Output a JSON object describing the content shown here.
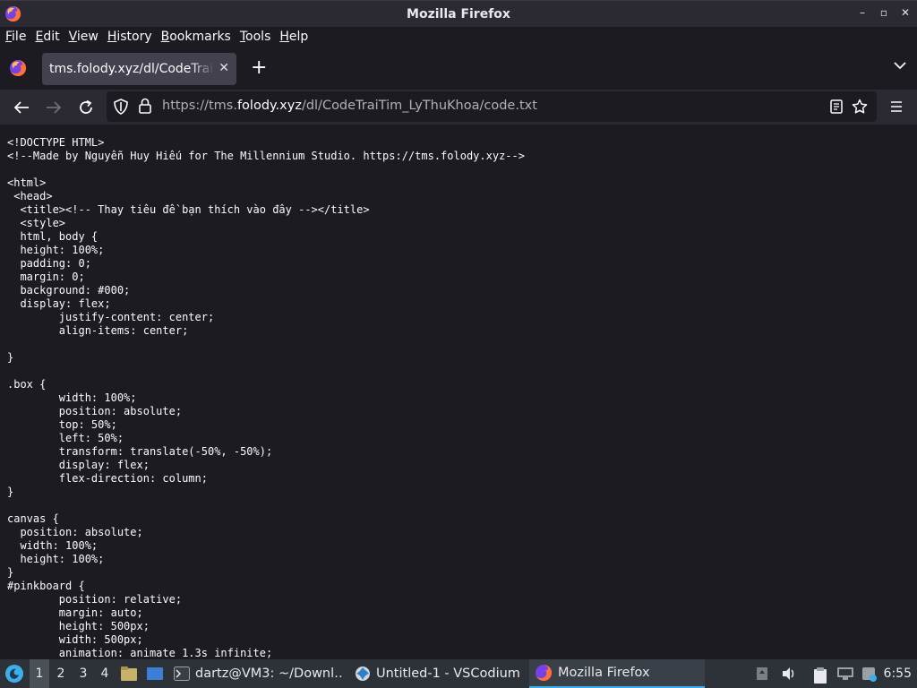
{
  "window": {
    "title": "Mozilla Firefox"
  },
  "menu": {
    "items": [
      {
        "label": "File",
        "accel": "F",
        "rest": "ile"
      },
      {
        "label": "Edit",
        "accel": "E",
        "rest": "dit"
      },
      {
        "label": "View",
        "accel": "V",
        "rest": "iew"
      },
      {
        "label": "History",
        "accel": "H",
        "rest": "istory"
      },
      {
        "label": "Bookmarks",
        "accel": "B",
        "rest": "ookmarks"
      },
      {
        "label": "Tools",
        "accel": "T",
        "rest": "ools"
      },
      {
        "label": "Help",
        "accel": "H",
        "rest": "elp"
      }
    ]
  },
  "tab": {
    "title": "tms.folody.xyz/dl/CodeTraiTim_LyThuKhoa/code.txt"
  },
  "address": {
    "prefix": "https://tms.",
    "domain": "folody.xyz",
    "path": "/dl/CodeTraiTim_LyThuKhoa/code.txt"
  },
  "page": {
    "code": "<!DOCTYPE HTML>\n<!--Made by Nguyễn Huy Hiếu for The Millennium Studio. https://tms.folody.xyz-->\n\n<html>\n <head>\n  <title><!-- Thay tiêu đề bạn thích vào đây --></title>\n  <style>\n  html, body {\n  height: 100%;\n  padding: 0;\n  margin: 0;\n  background: #000;\n  display: flex;\n        justify-content: center;\n        align-items: center;\n\n}\n\n.box {\n        width: 100%;\n        position: absolute;\n        top: 50%;\n        left: 50%;\n        transform: translate(-50%, -50%);\n        display: flex;\n        flex-direction: column;\n}\n\ncanvas {\n  position: absolute;\n  width: 100%;\n  height: 100%;\n}\n#pinkboard {\n        position: relative;\n        margin: auto;\n        height: 500px;\n        width: 500px;\n        animation: animate 1.3s infinite;"
  },
  "taskbar": {
    "workspaces": [
      "1",
      "2",
      "3",
      "4"
    ],
    "tasks": [
      {
        "label": "dartz@VM3: ~/Downl…",
        "icon": "terminal-icon"
      },
      {
        "label": "Untitled-1 - VSCodium",
        "icon": "vscodium-icon"
      },
      {
        "label": "Mozilla Firefox",
        "icon": "firefox-icon"
      }
    ],
    "clock": "6:55"
  },
  "colors": {
    "accent": "#3daee9",
    "content_bg": "#1c1b22",
    "toolbar_bg": "#2b2a33",
    "taskbar_bg": "#2d3238"
  }
}
